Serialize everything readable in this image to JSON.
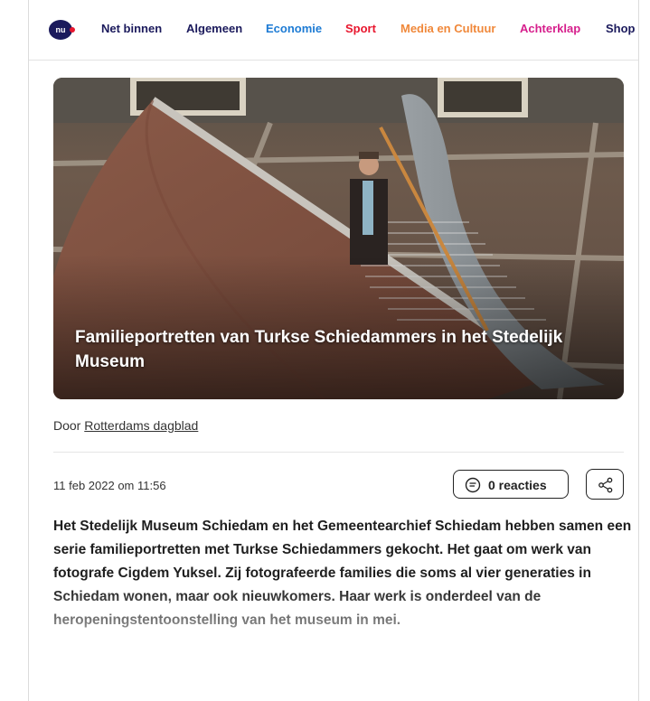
{
  "nav": {
    "logo_text": "nu",
    "items": [
      {
        "label": "Net binnen",
        "color": "#1b1a5c"
      },
      {
        "label": "Algemeen",
        "color": "#1b1a5c"
      },
      {
        "label": "Economie",
        "color": "#1d7bd4"
      },
      {
        "label": "Sport",
        "color": "#e8162e"
      },
      {
        "label": "Media en Cultuur",
        "color": "#f0883a"
      },
      {
        "label": "Achterklap",
        "color": "#d61f8c"
      },
      {
        "label": "Shop",
        "color": "#1b1a5c"
      }
    ]
  },
  "article": {
    "title": "Familieportretten van Turkse Schiedammers in het Stedelijk Museum",
    "byline_prefix": "Door",
    "author": "Rotterdams dagblad",
    "date": "11 feb 2022 om 11:56",
    "reactions_label": "0 reacties",
    "body": "Het Stedelijk Museum Schiedam en het Gemeentearchief Schiedam hebben samen een serie familieportretten met Turkse Schiedammers gekocht. Het gaat om werk van fotografe Cigdem Yuksel. Zij fotografeerde families die soms al vier generaties in Schiedam wonen, maar ook nieuwkomers. Haar werk is onderdeel van de heropeningstentoonstelling van het museum in mei."
  },
  "icons": {
    "logo": "nu-logo-icon",
    "reactions": "speech-bubble-icon",
    "share": "share-icon"
  }
}
